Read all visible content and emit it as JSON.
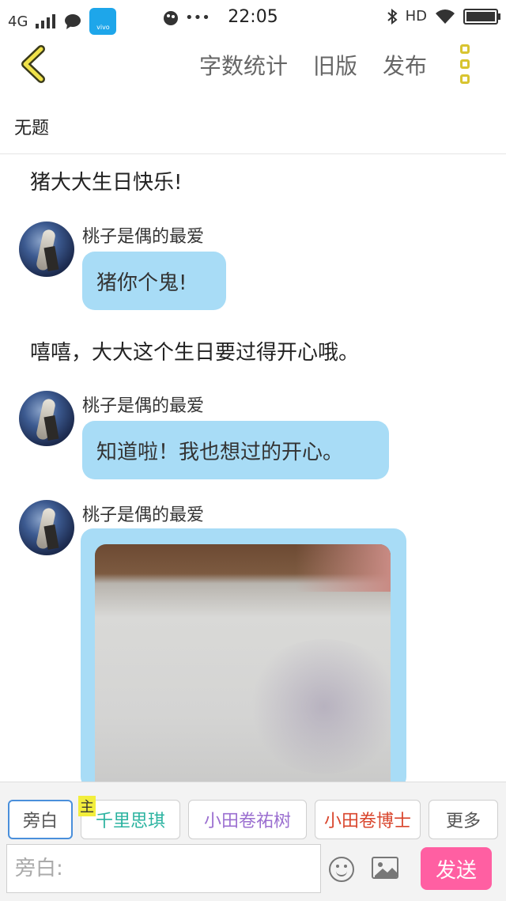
{
  "status_bar": {
    "network": "4G",
    "time": "22:05",
    "hd": "HD"
  },
  "nav": {
    "items": [
      "字数统计",
      "旧版",
      "发布"
    ]
  },
  "chapter": {
    "title": "无题"
  },
  "messages": [
    {
      "type": "narration",
      "text": "猪大大生日快乐!"
    },
    {
      "type": "character",
      "name": "桃子是偶的最爱",
      "text": "猪你个鬼!"
    },
    {
      "type": "narration",
      "text": "嘻嘻，大大这个生日要过得开心哦。"
    },
    {
      "type": "character",
      "name": "桃子是偶的最爱",
      "text": "知道啦！我也想过的开心。"
    },
    {
      "type": "character_image",
      "name": "桃子是偶的最爱"
    }
  ],
  "composer": {
    "chips": [
      {
        "label": "旁白",
        "color": "#555555"
      },
      {
        "label": "千里思琪",
        "color": "#2bb3a0",
        "tag": "主"
      },
      {
        "label": "小田卷祐树",
        "color": "#9b6fd0"
      },
      {
        "label": "小田卷博士",
        "color": "#d9452c"
      },
      {
        "label": "更多",
        "color": "#555555"
      }
    ],
    "placeholder": "旁白:",
    "send_label": "发送"
  }
}
